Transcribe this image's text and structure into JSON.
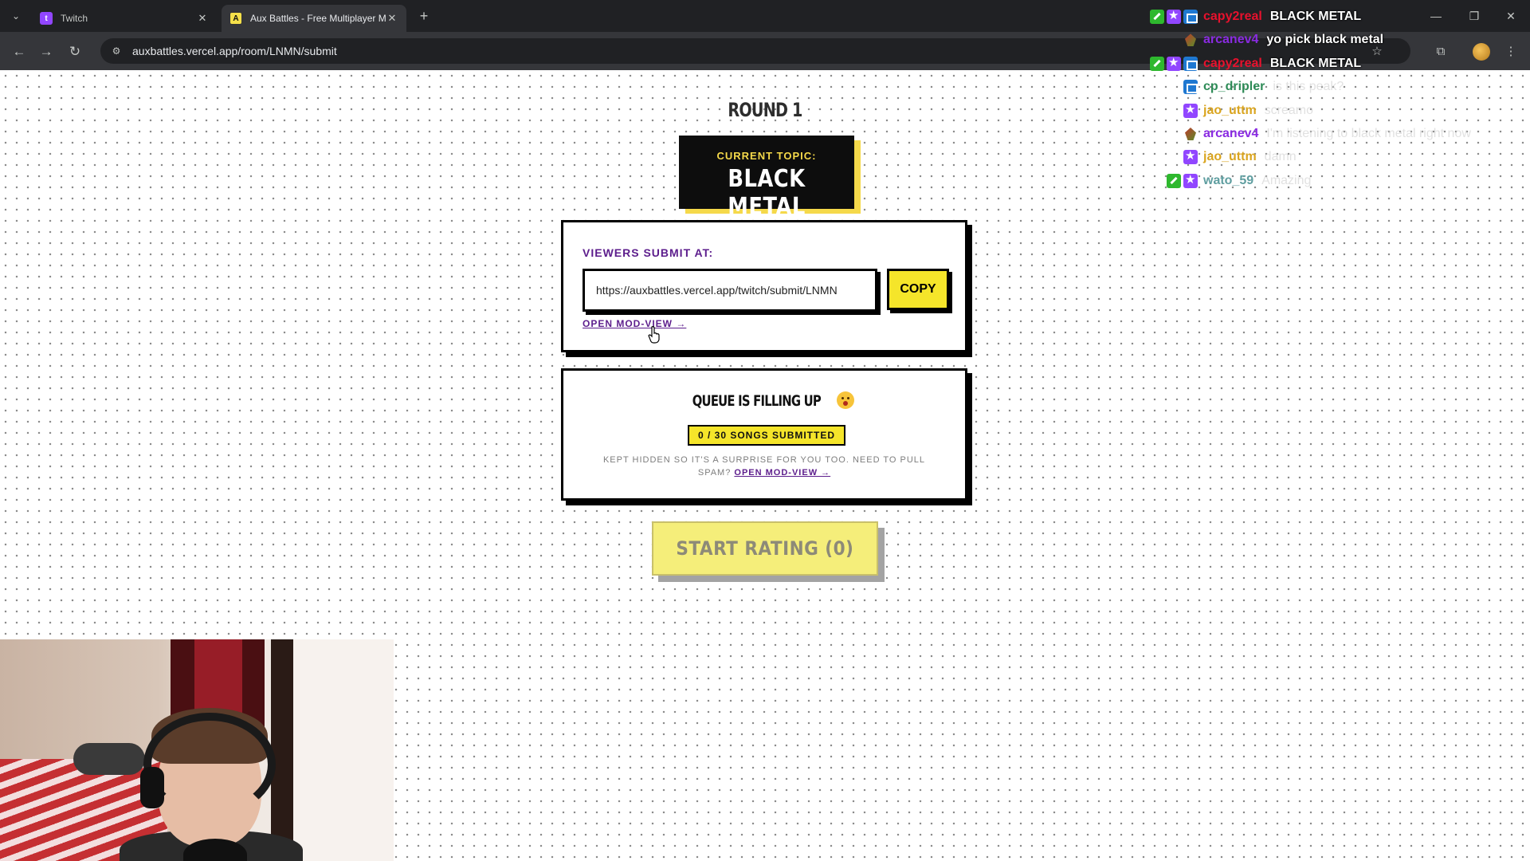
{
  "browser": {
    "tabs": [
      {
        "title": "Twitch",
        "favicon": "twitch-favicon",
        "active": false
      },
      {
        "title": "Aux Battles - Free Multiplayer M",
        "favicon": "auxbattles-favicon",
        "active": true
      }
    ],
    "url": "auxbattles.vercel.app/room/LNMN/submit"
  },
  "page": {
    "round_label": "ROUND 1",
    "topic": {
      "label": "CURRENT TOPIC:",
      "value": "BLACK METAL"
    },
    "submit": {
      "label": "VIEWERS SUBMIT AT:",
      "url_value": "https://auxbattles.vercel.app/twitch/submit/LNMN",
      "copy_label": "COPY",
      "modview_link": "OPEN MOD-VIEW →"
    },
    "queue": {
      "title": "QUEUE IS FILLING UP",
      "badge": "0 / 30 SONGS SUBMITTED",
      "hint": "KEPT HIDDEN SO IT'S A SURPRISE FOR YOU TOO. NEED TO PULL SPAM?",
      "hint_link": "OPEN MOD-VIEW →"
    },
    "start_button": "START RATING (0)"
  },
  "chat": [
    {
      "user": "capy2real",
      "color": "#e8112d",
      "text": "BLACK METAL",
      "badges": [
        "mod-badge-icon",
        "prime-badge-icon",
        "sub-badge-icon"
      ],
      "style": "bright"
    },
    {
      "user": "arcanev4",
      "color": "#8a2be2",
      "text": "yo pick black metal",
      "badges": [
        "bits-badge-icon"
      ],
      "style": "bright"
    },
    {
      "user": "capy2real",
      "color": "#e8112d",
      "text": "BLACK METAL",
      "badges": [
        "mod-badge-icon",
        "prime-badge-icon",
        "sub-badge-icon"
      ],
      "style": "bright"
    },
    {
      "user": "cp_dripler",
      "color": "#2e8b57",
      "text": "is this peak?",
      "badges": [
        "sub-badge-icon"
      ],
      "style": "faded"
    },
    {
      "user": "jao_uttm",
      "color": "#daa520",
      "text": "screamo",
      "badges": [
        "prime-badge-icon"
      ],
      "style": "faded"
    },
    {
      "user": "arcanev4",
      "color": "#8a2be2",
      "text": "I'm listening to black metal right now",
      "badges": [
        "bits-badge-icon"
      ],
      "style": "faded"
    },
    {
      "user": "jao_uttm",
      "color": "#daa520",
      "text": "damn",
      "badges": [
        "prime-badge-icon"
      ],
      "style": "faded"
    },
    {
      "user": "wato_59",
      "color": "#5f9ea0",
      "text": "Amazing",
      "badges": [
        "mod-badge-icon",
        "prime-badge-icon"
      ],
      "style": "faded"
    }
  ]
}
